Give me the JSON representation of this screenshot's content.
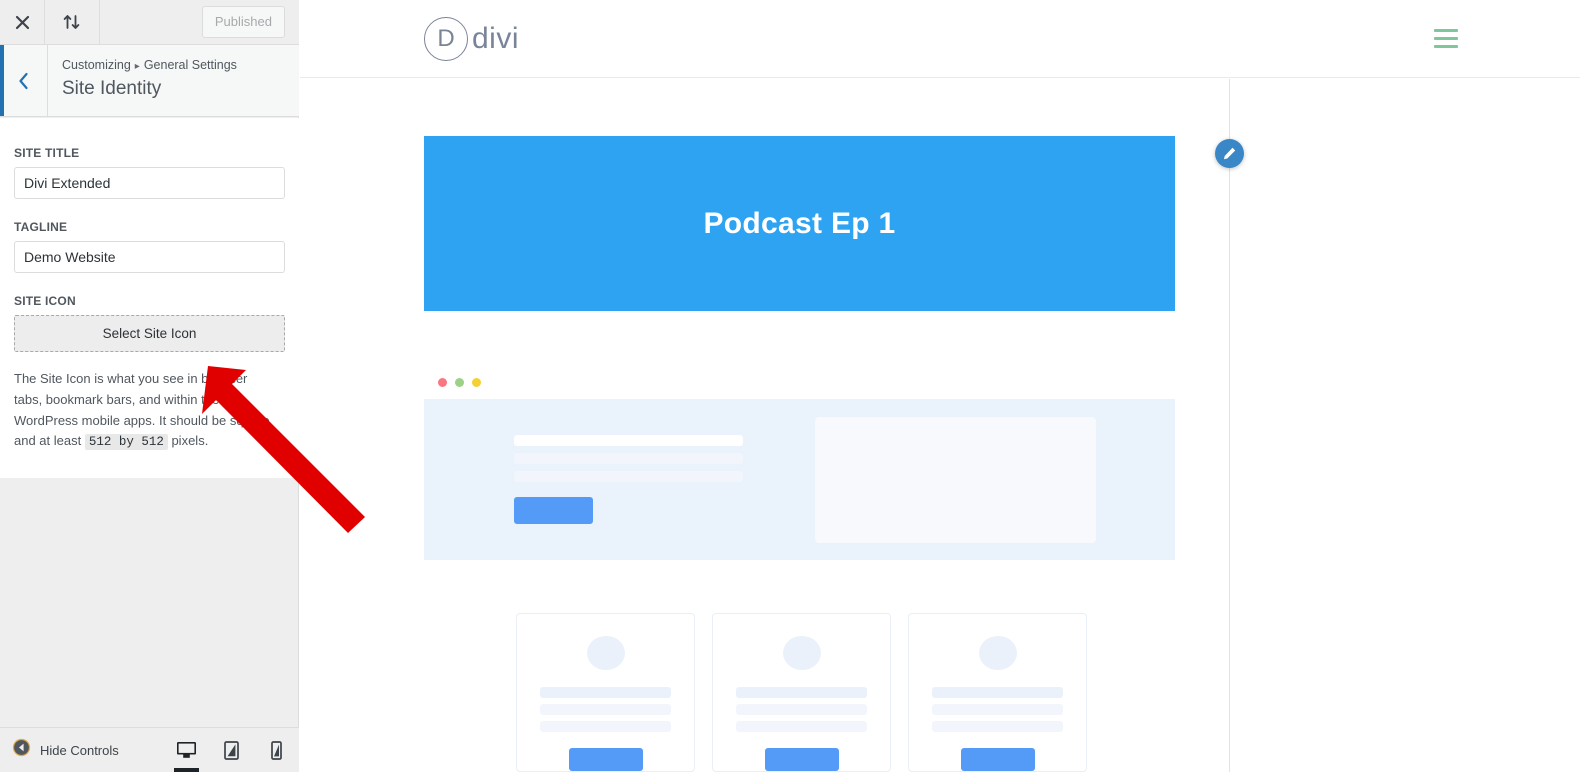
{
  "customizer": {
    "topbar": {
      "close_icon": "close-icon",
      "sort_icon": "collapse-sort-icon",
      "publish_label": "Published"
    },
    "panel": {
      "back_icon": "chevron-left-icon",
      "breadcrumb_root": "Customizing",
      "breadcrumb_separator": "▸",
      "breadcrumb_section": "General Settings",
      "title": "Site Identity"
    },
    "fields": {
      "site_title_label": "SITE TITLE",
      "site_title_value": "Divi Extended",
      "site_title_placeholder": "",
      "tagline_label": "TAGLINE",
      "tagline_value": "Demo Website",
      "tagline_placeholder": "",
      "site_icon_label": "SITE ICON",
      "site_icon_button": "Select Site Icon",
      "site_icon_desc_part1": "The Site Icon is what you see in browser tabs, bookmark bars, and within the WordPress mobile apps. It should be square and at least ",
      "site_icon_desc_code": "512 by 512",
      "site_icon_desc_part2": " pixels."
    },
    "footer": {
      "hide_controls_label": "Hide Controls",
      "hide_icon": "collapse-left-icon",
      "devices": [
        {
          "name": "desktop",
          "icon": "desktop-icon",
          "active": true
        },
        {
          "name": "tablet",
          "icon": "tablet-icon",
          "active": false
        },
        {
          "name": "mobile",
          "icon": "mobile-icon",
          "active": false
        }
      ]
    }
  },
  "preview": {
    "site_header": {
      "logo_mark": "D",
      "logo_word": "divi",
      "menu_icon": "hamburger-menu-icon",
      "menu_color": "#7ec79a"
    },
    "hero": {
      "title": "Podcast Ep 1",
      "background": "#2ea3f2",
      "text_color": "#ffffff"
    },
    "edit_fab": {
      "icon": "pencil-edit-icon",
      "color": "#3a87c8"
    },
    "skeleton": {
      "dots": [
        {
          "name": "dot-red",
          "color": "#f9777f"
        },
        {
          "name": "dot-green",
          "color": "#9dd185"
        },
        {
          "name": "dot-yellow",
          "color": "#f5d033"
        }
      ],
      "panel_background": "#eaf2fb",
      "button_color": "#549bf7",
      "lines": 3,
      "image_placeholder_color": "#f7f9fd"
    },
    "cards": [
      {
        "name": "card-1",
        "lines": 3,
        "button_color": "#549bf7"
      },
      {
        "name": "card-2",
        "lines": 3,
        "button_color": "#549bf7"
      },
      {
        "name": "card-3",
        "lines": 3,
        "button_color": "#549bf7"
      }
    ]
  },
  "annotation": {
    "arrow_color": "#e00000",
    "points_to": "Select Site Icon"
  }
}
